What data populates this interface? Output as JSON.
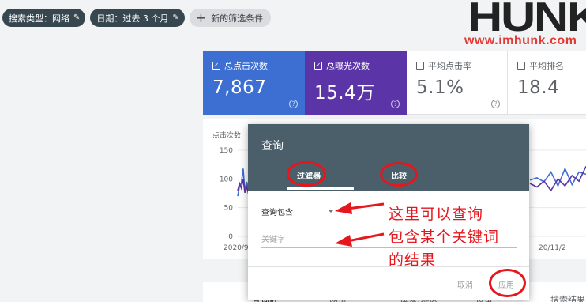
{
  "filters": {
    "search_type": "搜索类型：网络",
    "date": "日期：过去 3 个月",
    "new_filter": "新的筛选条件"
  },
  "logo": {
    "word": "HUNK",
    "url": "www.imhunk.com"
  },
  "metrics": [
    {
      "label": "总点击次数",
      "value": "7,867",
      "checked": true,
      "color": "#3d6fd3"
    },
    {
      "label": "总曝光次数",
      "value": "15.4万",
      "checked": true,
      "color": "#5b34a8"
    },
    {
      "label": "平均点击率",
      "value": "5.1%",
      "checked": false
    },
    {
      "label": "平均排名",
      "value": "18.4",
      "checked": false
    }
  ],
  "chart": {
    "ylabel": "点击次数",
    "ticks": [
      "150",
      "100",
      "50",
      "0"
    ],
    "x_left": "2020/9/",
    "x_right": "20/11/2"
  },
  "chart_data": {
    "type": "line",
    "ylabel": "点击次数",
    "ylim": [
      0,
      150
    ],
    "series": [
      {
        "color": "#3d6fd3",
        "left": [
          70,
          88,
          92,
          118,
          80,
          95,
          82,
          66
        ],
        "right": [
          98,
          102,
          95,
          112,
          88,
          118,
          90,
          112,
          108
        ]
      },
      {
        "color": "#5b34a8",
        "left": [
          80,
          92,
          84,
          100,
          76,
          86,
          74,
          60
        ],
        "right": [
          92,
          86,
          96,
          80,
          100,
          88,
          106,
          96,
          122
        ]
      }
    ]
  },
  "table_header": [
    "查询数",
    "网页",
    "国家/地区",
    "设备",
    "搜索结果"
  ],
  "dialog": {
    "title": "查询",
    "tab_filter": "过滤器",
    "tab_compare": "比较",
    "select_value": "查询包含",
    "keyword_placeholder": "关键字",
    "cancel": "取消",
    "apply": "应用"
  },
  "annotation": {
    "line1": "这里可以查询",
    "line2": "包含某个关键词",
    "line3": "的结果",
    "color": "#e5161d"
  }
}
